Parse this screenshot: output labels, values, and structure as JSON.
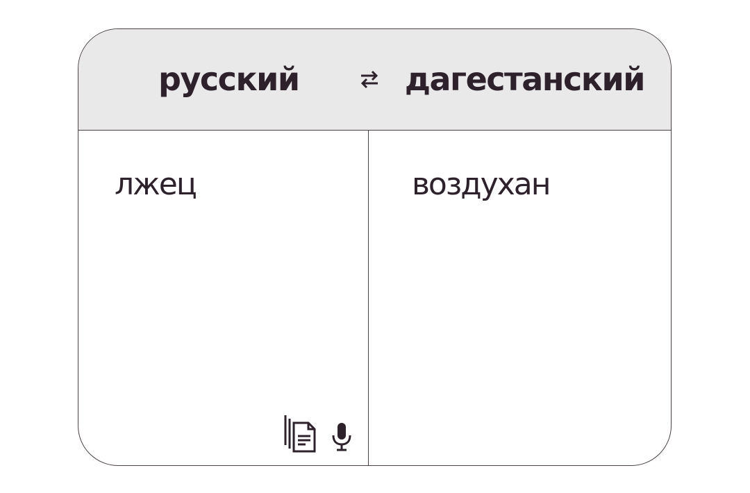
{
  "header": {
    "source_language": "русский",
    "target_language": "дагестанский",
    "swap_icon": "swap-arrows-icon"
  },
  "source_pane": {
    "text": "лжец",
    "copy_icon": "copy-document-icon",
    "mic_icon": "microphone-icon"
  },
  "target_pane": {
    "text": "воздухан"
  },
  "colors": {
    "text": "#2d222c",
    "header_background": "#e9e9ea",
    "border": "#4a4048",
    "background": "#ffffff"
  }
}
